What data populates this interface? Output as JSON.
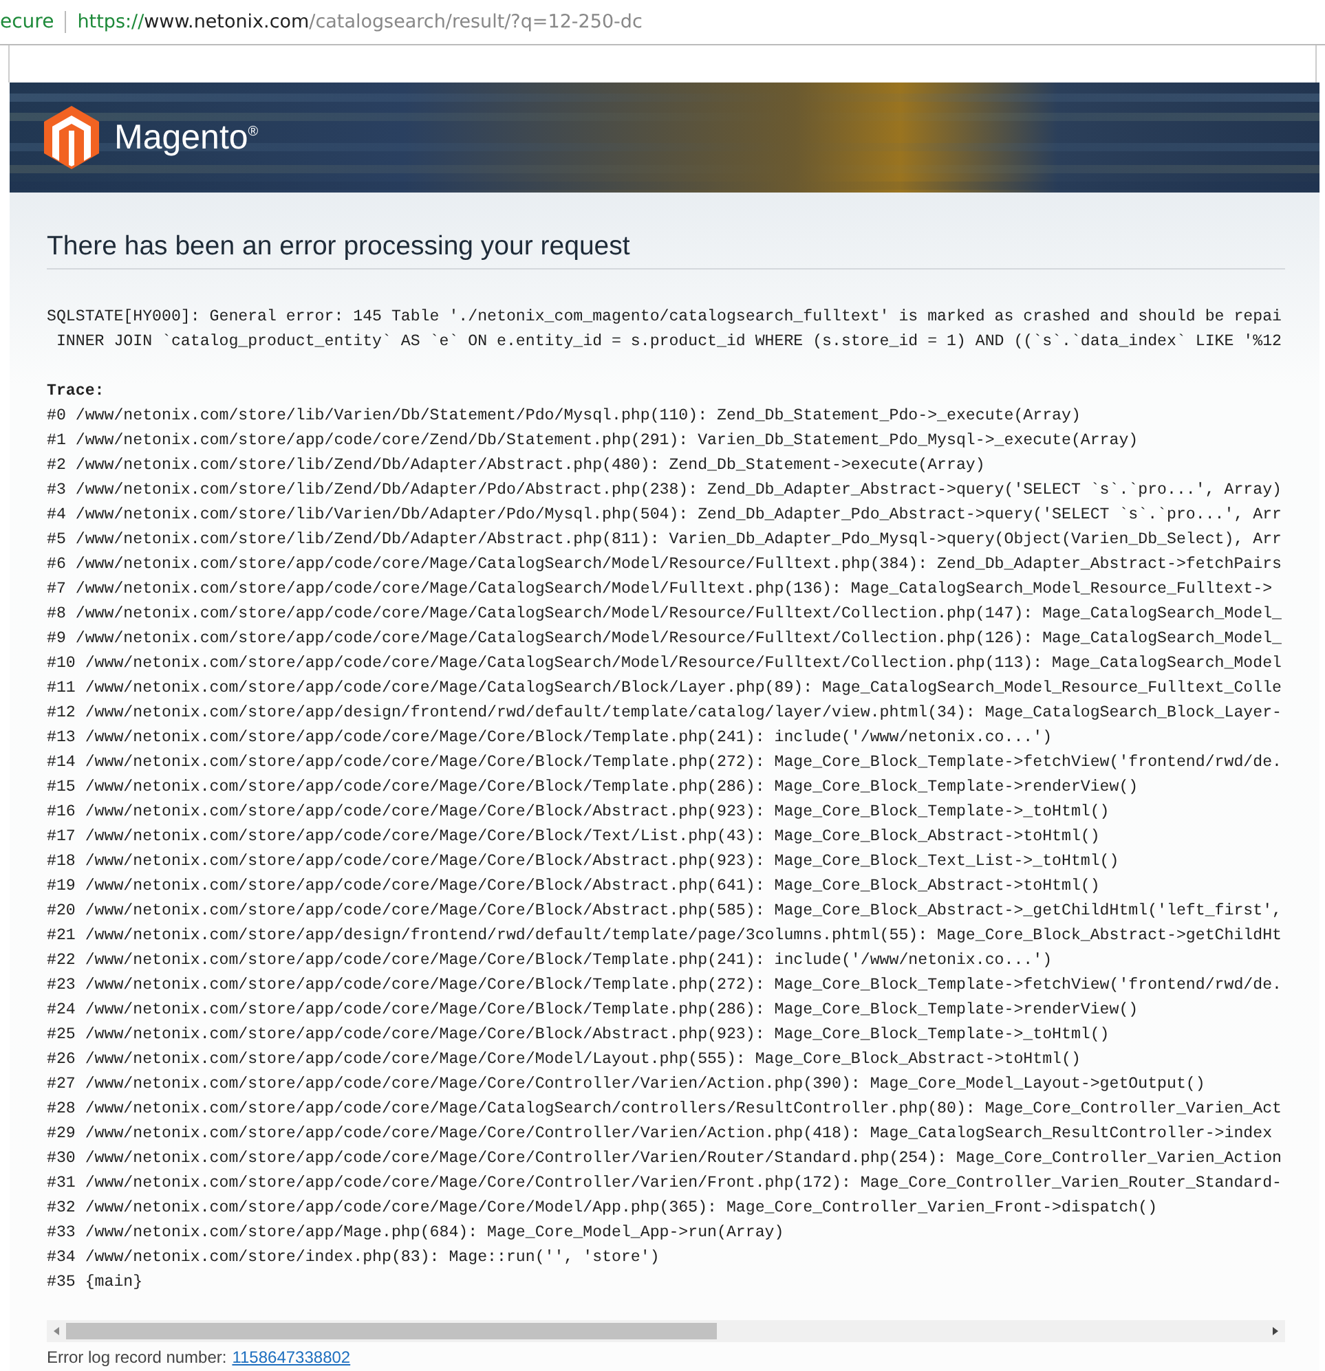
{
  "address_bar": {
    "security_label": "ecure",
    "url_scheme": "https://",
    "url_host": "www.netonix.com",
    "url_path": "/catalogsearch/result/?q=12-250-dc"
  },
  "header": {
    "logo_text": "Magento$^{®}$"
  },
  "error": {
    "title": "There has been an error processing your request",
    "message_lines": [
      "SQLSTATE[HY000]: General error: 145 Table './netonix_com_magento/catalogsearch_fulltext' is marked as crashed and should be repai",
      " INNER JOIN `catalog_product_entity` AS `e` ON e.entity_id = s.product_id WHERE (s.store_id = 1) AND ((`s`.`data_index` LIKE '%12"
    ],
    "trace_heading": "Trace:",
    "trace_lines": [
      "#0 /www/netonix.com/store/lib/Varien/Db/Statement/Pdo/Mysql.php(110): Zend_Db_Statement_Pdo->_execute(Array)",
      "#1 /www/netonix.com/store/app/code/core/Zend/Db/Statement.php(291): Varien_Db_Statement_Pdo_Mysql->_execute(Array)",
      "#2 /www/netonix.com/store/lib/Zend/Db/Adapter/Abstract.php(480): Zend_Db_Statement->execute(Array)",
      "#3 /www/netonix.com/store/lib/Zend/Db/Adapter/Pdo/Abstract.php(238): Zend_Db_Adapter_Abstract->query('SELECT `s`.`pro...', Array)",
      "#4 /www/netonix.com/store/lib/Varien/Db/Adapter/Pdo/Mysql.php(504): Zend_Db_Adapter_Pdo_Abstract->query('SELECT `s`.`pro...', Arr",
      "#5 /www/netonix.com/store/lib/Zend/Db/Adapter/Abstract.php(811): Varien_Db_Adapter_Pdo_Mysql->query(Object(Varien_Db_Select), Arr",
      "#6 /www/netonix.com/store/app/code/core/Mage/CatalogSearch/Model/Resource/Fulltext.php(384): Zend_Db_Adapter_Abstract->fetchPairs",
      "#7 /www/netonix.com/store/app/code/core/Mage/CatalogSearch/Model/Fulltext.php(136): Mage_CatalogSearch_Model_Resource_Fulltext->",
      "#8 /www/netonix.com/store/app/code/core/Mage/CatalogSearch/Model/Resource/Fulltext/Collection.php(147): Mage_CatalogSearch_Model_",
      "#9 /www/netonix.com/store/app/code/core/Mage/CatalogSearch/Model/Resource/Fulltext/Collection.php(126): Mage_CatalogSearch_Model_",
      "#10 /www/netonix.com/store/app/code/core/Mage/CatalogSearch/Model/Resource/Fulltext/Collection.php(113): Mage_CatalogSearch_Model",
      "#11 /www/netonix.com/store/app/code/core/Mage/CatalogSearch/Block/Layer.php(89): Mage_CatalogSearch_Model_Resource_Fulltext_Colle",
      "#12 /www/netonix.com/store/app/design/frontend/rwd/default/template/catalog/layer/view.phtml(34): Mage_CatalogSearch_Block_Layer-",
      "#13 /www/netonix.com/store/app/code/core/Mage/Core/Block/Template.php(241): include('/www/netonix.co...')",
      "#14 /www/netonix.com/store/app/code/core/Mage/Core/Block/Template.php(272): Mage_Core_Block_Template->fetchView('frontend/rwd/de.",
      "#15 /www/netonix.com/store/app/code/core/Mage/Core/Block/Template.php(286): Mage_Core_Block_Template->renderView()",
      "#16 /www/netonix.com/store/app/code/core/Mage/Core/Block/Abstract.php(923): Mage_Core_Block_Template->_toHtml()",
      "#17 /www/netonix.com/store/app/code/core/Mage/Core/Block/Text/List.php(43): Mage_Core_Block_Abstract->toHtml()",
      "#18 /www/netonix.com/store/app/code/core/Mage/Core/Block/Abstract.php(923): Mage_Core_Block_Text_List->_toHtml()",
      "#19 /www/netonix.com/store/app/code/core/Mage/Core/Block/Abstract.php(641): Mage_Core_Block_Abstract->toHtml()",
      "#20 /www/netonix.com/store/app/code/core/Mage/Core/Block/Abstract.php(585): Mage_Core_Block_Abstract->_getChildHtml('left_first',",
      "#21 /www/netonix.com/store/app/design/frontend/rwd/default/template/page/3columns.phtml(55): Mage_Core_Block_Abstract->getChildHt",
      "#22 /www/netonix.com/store/app/code/core/Mage/Core/Block/Template.php(241): include('/www/netonix.co...')",
      "#23 /www/netonix.com/store/app/code/core/Mage/Core/Block/Template.php(272): Mage_Core_Block_Template->fetchView('frontend/rwd/de.",
      "#24 /www/netonix.com/store/app/code/core/Mage/Core/Block/Template.php(286): Mage_Core_Block_Template->renderView()",
      "#25 /www/netonix.com/store/app/code/core/Mage/Core/Block/Abstract.php(923): Mage_Core_Block_Template->_toHtml()",
      "#26 /www/netonix.com/store/app/code/core/Mage/Core/Model/Layout.php(555): Mage_Core_Block_Abstract->toHtml()",
      "#27 /www/netonix.com/store/app/code/core/Mage/Core/Controller/Varien/Action.php(390): Mage_Core_Model_Layout->getOutput()",
      "#28 /www/netonix.com/store/app/code/core/Mage/CatalogSearch/controllers/ResultController.php(80): Mage_Core_Controller_Varien_Act",
      "#29 /www/netonix.com/store/app/code/core/Mage/Core/Controller/Varien/Action.php(418): Mage_CatalogSearch_ResultController->index",
      "#30 /www/netonix.com/store/app/code/core/Mage/Core/Controller/Varien/Router/Standard.php(254): Mage_Core_Controller_Varien_Action",
      "#31 /www/netonix.com/store/app/code/core/Mage/Core/Controller/Varien/Front.php(172): Mage_Core_Controller_Varien_Router_Standard-",
      "#32 /www/netonix.com/store/app/code/core/Mage/Core/Model/App.php(365): Mage_Core_Controller_Varien_Front->dispatch()",
      "#33 /www/netonix.com/store/app/Mage.php(684): Mage_Core_Model_App->run(Array)",
      "#34 /www/netonix.com/store/index.php(83): Mage::run('', 'store')",
      "#35 {main}"
    ],
    "log_label": "Error log record number:",
    "log_link": "1158647338802"
  }
}
